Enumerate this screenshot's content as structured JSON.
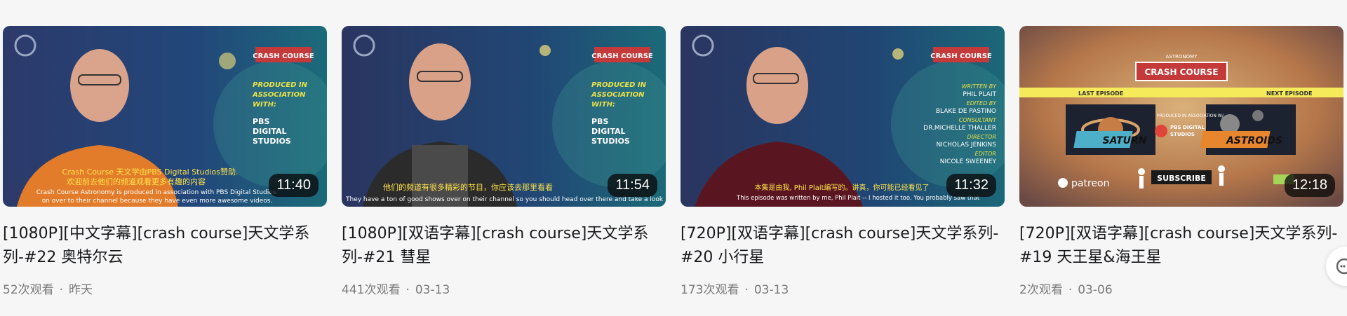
{
  "videos": [
    {
      "title": "[1080P][中文字幕][crash course]天文学系列-#22 奥特尔云",
      "views": "52次观看",
      "date": "昨天",
      "duration": "11:40",
      "thumb": {
        "logo": "CRASH COURSE",
        "credit_lines": [
          "PRODUCED IN",
          "ASSOCIATION",
          "WITH:"
        ],
        "studio_lines": [
          "PBS",
          "DIGITAL",
          "STUDIOS"
        ],
        "subtitle_cn": "Crash Course 天文学由PBS Digital Studios赞助.",
        "subtitle_cn2": "欢迎前去他们的频道观看更多有趣的内容",
        "subtitle_en": "Crash Course Astronomy is produced in association with PBS Digital Studios.",
        "subtitle_en2": "on over to their channel because they have even more awesome videos."
      }
    },
    {
      "title": "[1080P][双语字幕][crash course]天文学系列-#21 彗星",
      "views": "441次观看",
      "date": "03-13",
      "duration": "11:54",
      "thumb": {
        "logo": "CRASH COURSE",
        "credit_lines": [
          "PRODUCED IN",
          "ASSOCIATION",
          "WITH:"
        ],
        "studio_lines": [
          "PBS",
          "DIGITAL",
          "STUDIOS"
        ],
        "subtitle_cn": "他们的频道有很多精彩的节目，你应该去那里看看",
        "subtitle_en": "They have a ton of good shows over on their channel so you should head over there and take a look"
      }
    },
    {
      "title": "[720P][双语字幕][crash course]天文学系列-#20 小行星",
      "views": "173次观看",
      "date": "03-13",
      "duration": "11:32",
      "thumb": {
        "logo": "CRASH COURSE",
        "credit_lines": [
          "WRITTEN BY",
          "PHIL PLAIT",
          "EDITED BY",
          "BLAKE DE PASTINO",
          "CONSULTANT",
          "DR.MICHELLE THALLER",
          "DIRECTOR",
          "NICHOLAS JENKINS",
          "EDITOR",
          "NICOLE SWEENEY"
        ],
        "subtitle_cn": "本集是由我, Phil Plait编写的。讲真，你可能已经看见了",
        "subtitle_en": "This episode was written by me, Phil Plait -- I hosted it too. You probably saw that"
      }
    },
    {
      "title": "[720P][双语字幕][crash course]天文学系列-#19 天王星&海王星",
      "views": "2次观看",
      "date": "03-06",
      "duration": "12:18",
      "thumb": {
        "logo": "CRASH COURSE",
        "astro": "ASTRONOMY",
        "last_ep": "LAST EPISODE",
        "next_ep": "NEXT EPISODE",
        "left_card": "SATURN",
        "right_card": "ASTROIDS",
        "subscribe": "SUBSCRIBE",
        "patreon": "patreon",
        "center_lines": [
          "PRODUCED IN ASSOCIATION W/",
          "PBS DIGITAL",
          "STUDIOS"
        ]
      }
    }
  ]
}
